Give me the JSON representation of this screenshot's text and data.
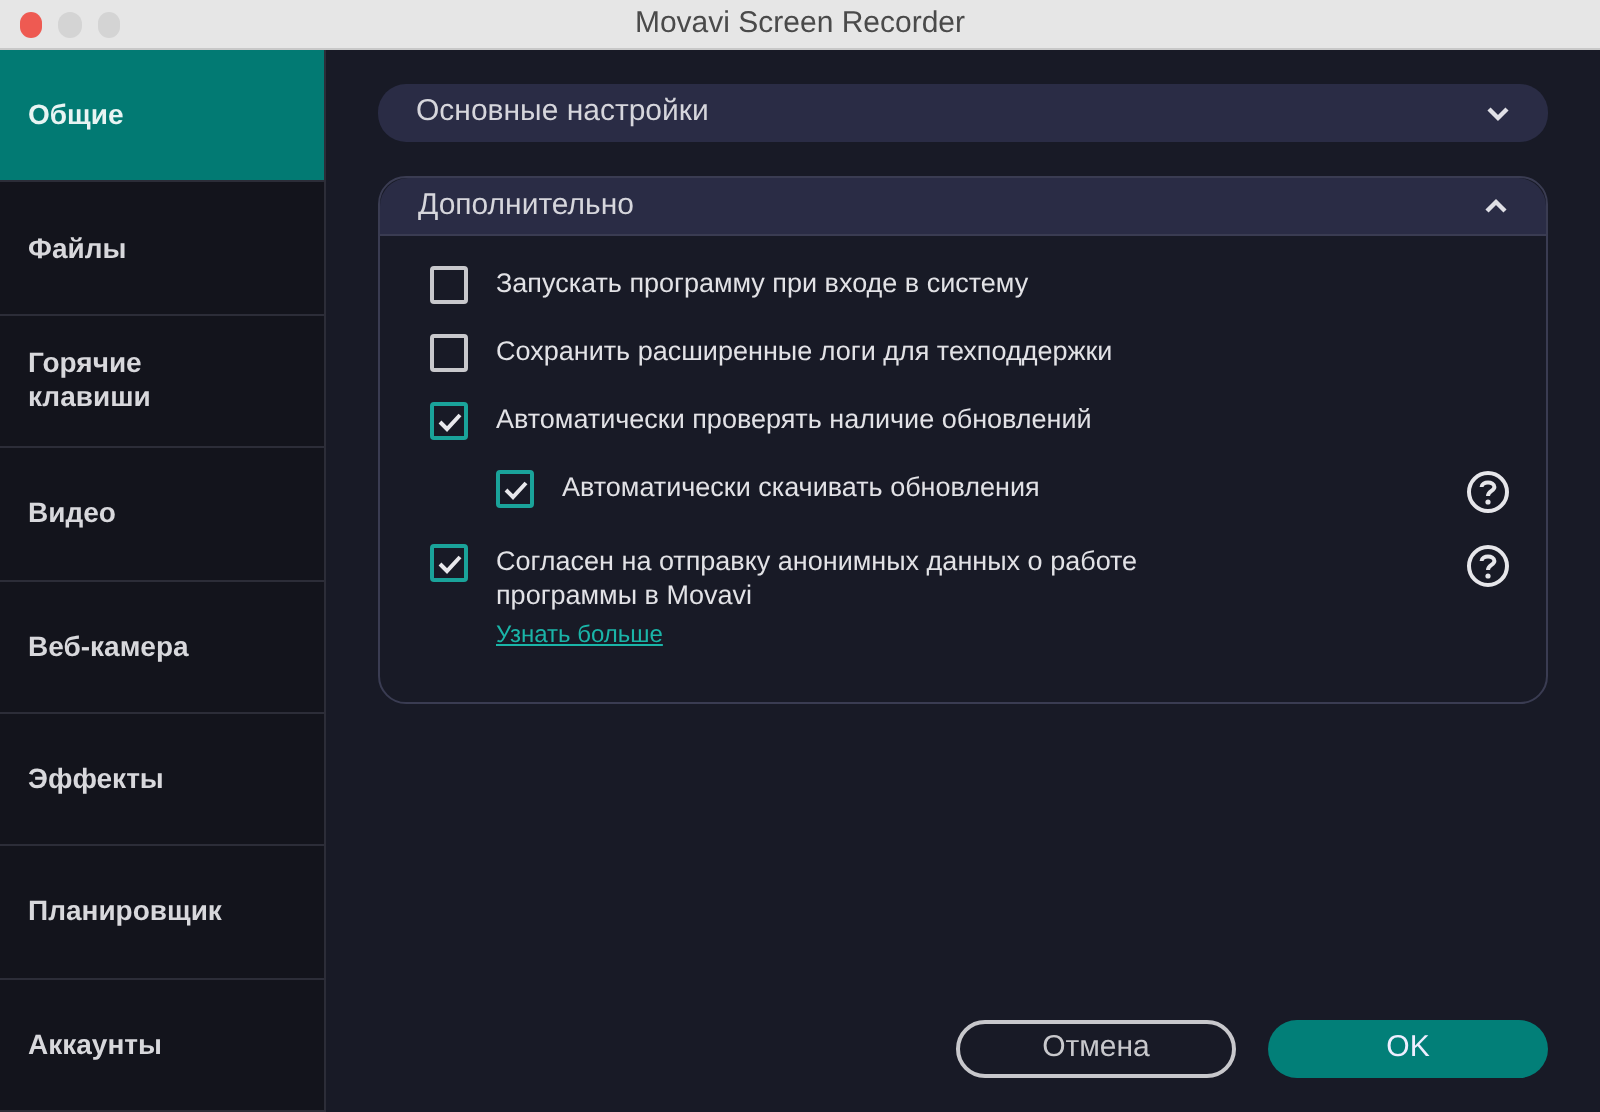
{
  "window": {
    "title": "Movavi Screen Recorder"
  },
  "sidebar": {
    "items": [
      {
        "label": "Общие",
        "selected": true
      },
      {
        "label": "Файлы",
        "selected": false
      },
      {
        "label": "Горячие клавиши",
        "selected": false
      },
      {
        "label": "Видео",
        "selected": false
      },
      {
        "label": "Веб-камера",
        "selected": false
      },
      {
        "label": "Эффекты",
        "selected": false
      },
      {
        "label": "Планировщик",
        "selected": false
      },
      {
        "label": "Аккаунты",
        "selected": false
      }
    ]
  },
  "sections": [
    {
      "title": "Основные настройки",
      "expanded": false
    },
    {
      "title": "Дополнительно",
      "expanded": true,
      "options": [
        {
          "label": "Запускать программу при входе в систему",
          "checked": false,
          "help": false
        },
        {
          "label": "Сохранить расширенные логи для техподдержки",
          "checked": false,
          "help": false
        },
        {
          "label": "Автоматически проверять наличие обновлений",
          "checked": true,
          "help": false,
          "children": [
            {
              "label": "Автоматически скачивать обновления",
              "checked": true,
              "help": true
            }
          ]
        },
        {
          "label": "Согласен на отправку анонимных данных о работе программы в Movavi",
          "checked": true,
          "help": true,
          "link": "Узнать больше"
        }
      ]
    }
  ],
  "buttons": [
    {
      "label": "Отмена",
      "kind": "secondary"
    },
    {
      "label": "OK",
      "kind": "primary"
    }
  ]
}
